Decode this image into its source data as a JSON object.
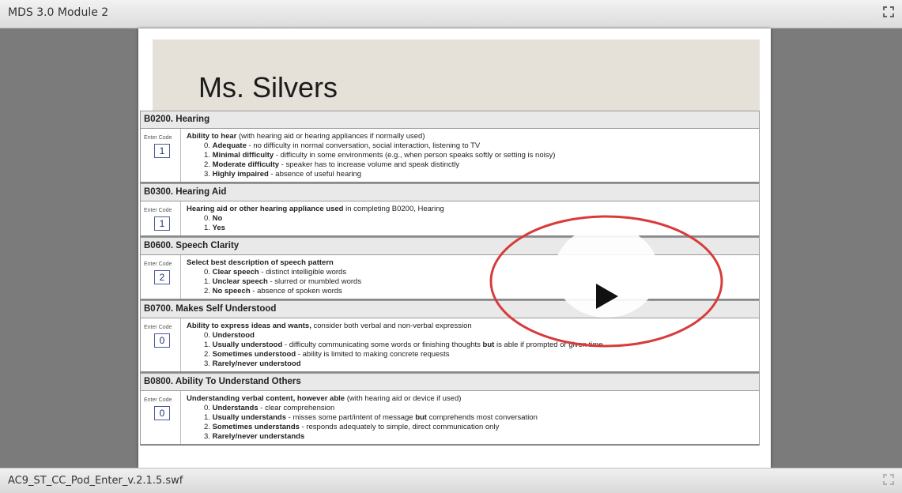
{
  "window": {
    "title": "MDS 3.0 Module 2",
    "file_name": "AC9_ST_CC_Pod_Enter_v.2.1.5.swf"
  },
  "header": {
    "resident_name": "Ms. Silvers"
  },
  "enter_code_label": "Enter Code",
  "sections": [
    {
      "heading": "B0200. Hearing",
      "code": "1",
      "question_bold": "Ability to hear",
      "question_rest": " (with hearing aid or hearing appliances if normally used)",
      "options": [
        {
          "num": "0.",
          "label": "Adequate",
          "desc": " - no difficulty in normal conversation, social interaction, listening to TV"
        },
        {
          "num": "1.",
          "label": "Minimal difficulty",
          "desc": " - difficulty in some environments (e.g., when person speaks softly or setting is noisy)"
        },
        {
          "num": "2.",
          "label": "Moderate difficulty",
          "desc": " - speaker has to increase volume and speak distinctly"
        },
        {
          "num": "3.",
          "label": "Highly impaired",
          "desc": " - absence of useful hearing"
        }
      ]
    },
    {
      "heading": "B0300. Hearing Aid",
      "code": "1",
      "question_bold": "Hearing aid or other hearing appliance used",
      "question_rest": " in completing B0200, Hearing",
      "options": [
        {
          "num": "0.",
          "label": "No",
          "desc": ""
        },
        {
          "num": "1.",
          "label": "Yes",
          "desc": ""
        }
      ]
    },
    {
      "heading": "B0600. Speech Clarity",
      "code": "2",
      "question_bold": "Select best description of speech pattern",
      "question_rest": "",
      "options": [
        {
          "num": "0.",
          "label": "Clear speech",
          "desc": " - distinct intelligible words"
        },
        {
          "num": "1.",
          "label": "Unclear speech",
          "desc": " - slurred or mumbled words"
        },
        {
          "num": "2.",
          "label": "No speech",
          "desc": " - absence of spoken words"
        }
      ]
    },
    {
      "heading": "B0700. Makes Self Understood",
      "code": "0",
      "question_bold": "Ability to express ideas and wants,",
      "question_rest": " consider both verbal and non-verbal expression",
      "options": [
        {
          "num": "0.",
          "label": "Understood",
          "desc": ""
        },
        {
          "num": "1.",
          "label": "Usually understood",
          "desc": " - difficulty communicating some words or finishing thoughts ",
          "bold2": "but",
          "desc2": " is able if prompted or given time"
        },
        {
          "num": "2.",
          "label": "Sometimes understood",
          "desc": " - ability is limited to making concrete requests"
        },
        {
          "num": "3.",
          "label": "Rarely/never understood",
          "desc": ""
        }
      ]
    },
    {
      "heading": "B0800. Ability To Understand Others",
      "code": "0",
      "question_bold": "Understanding verbal content, however able",
      "question_rest": " (with hearing aid or device if used)",
      "options": [
        {
          "num": "0.",
          "label": "Understands",
          "desc": " - clear comprehension"
        },
        {
          "num": "1.",
          "label": "Usually understands",
          "desc": " - misses some part/intent of message ",
          "bold2": "but",
          "desc2": " comprehends most conversation"
        },
        {
          "num": "2.",
          "label": "Sometimes understands",
          "desc": " - responds adequately to simple, direct communication only"
        },
        {
          "num": "3.",
          "label": "Rarely/never understands",
          "desc": ""
        }
      ]
    }
  ],
  "icons": {
    "fullscreen": "fullscreen-icon",
    "play": "play-icon"
  },
  "colors": {
    "annotation_ring": "#d93a3a",
    "code_box": "#4a5a9a"
  }
}
